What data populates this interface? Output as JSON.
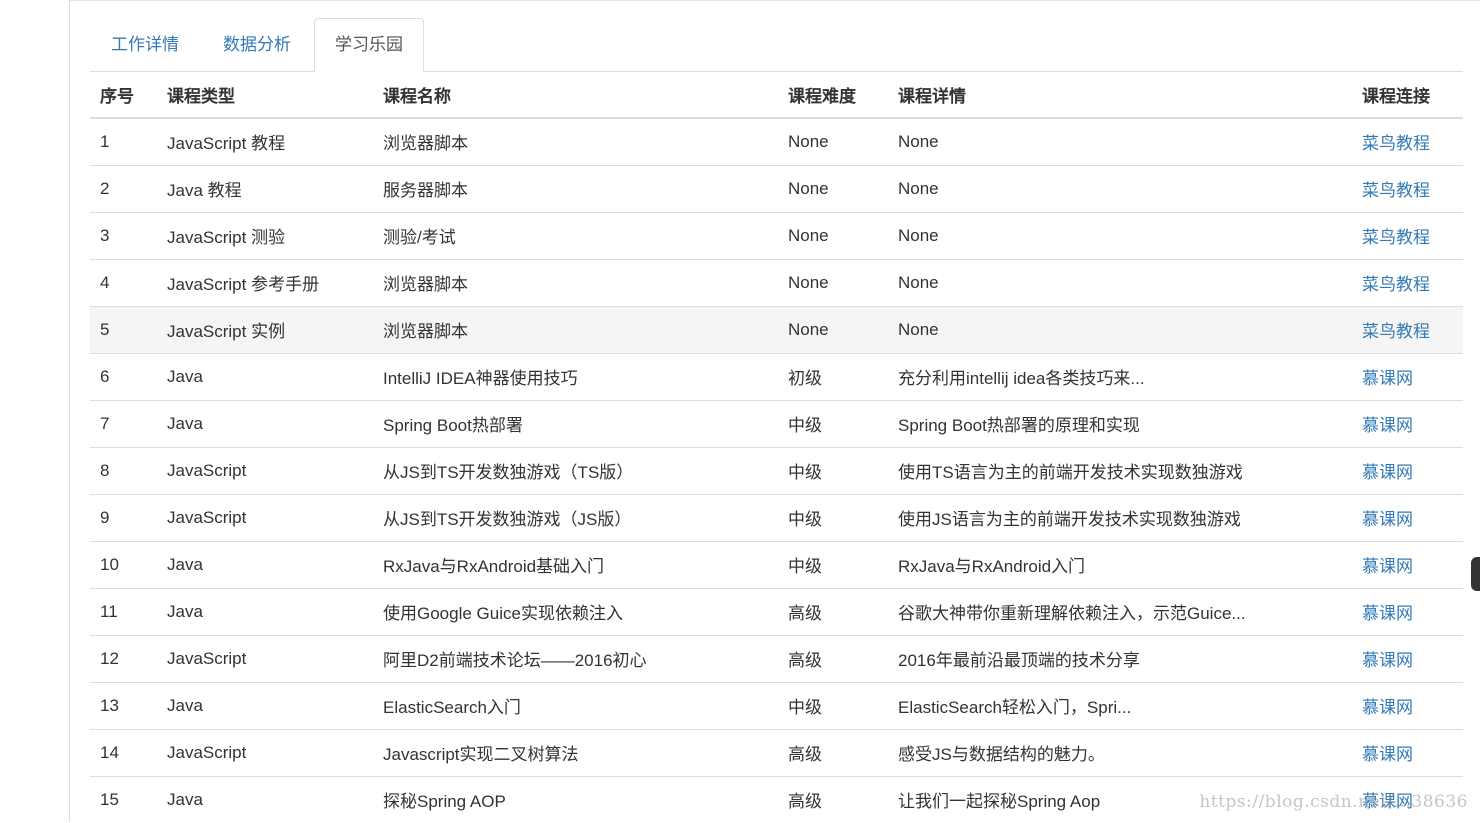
{
  "tabs": [
    {
      "label": "工作详情",
      "active": false
    },
    {
      "label": "数据分析",
      "active": false
    },
    {
      "label": "学习乐园",
      "active": true
    }
  ],
  "table": {
    "headers": [
      "序号",
      "课程类型",
      "课程名称",
      "课程难度",
      "课程详情",
      "课程连接"
    ],
    "rows": [
      {
        "id": "1",
        "type": "JavaScript 教程",
        "name": "浏览器脚本",
        "level": "None",
        "detail": "None",
        "link": "菜鸟教程"
      },
      {
        "id": "2",
        "type": "Java 教程",
        "name": "服务器脚本",
        "level": "None",
        "detail": "None",
        "link": "菜鸟教程"
      },
      {
        "id": "3",
        "type": "JavaScript 测验",
        "name": "测验/考试",
        "level": "None",
        "detail": "None",
        "link": "菜鸟教程"
      },
      {
        "id": "4",
        "type": "JavaScript 参考手册",
        "name": "浏览器脚本",
        "level": "None",
        "detail": "None",
        "link": "菜鸟教程"
      },
      {
        "id": "5",
        "type": "JavaScript 实例",
        "name": "浏览器脚本",
        "level": "None",
        "detail": "None",
        "link": "菜鸟教程",
        "hover": true
      },
      {
        "id": "6",
        "type": "Java",
        "name": "IntelliJ IDEA神器使用技巧",
        "level": "初级",
        "detail": "充分利用intellij idea各类技巧来...",
        "link": "慕课网"
      },
      {
        "id": "7",
        "type": "Java",
        "name": "Spring Boot热部署",
        "level": "中级",
        "detail": "Spring Boot热部署的原理和实现",
        "link": "慕课网"
      },
      {
        "id": "8",
        "type": "JavaScript",
        "name": "从JS到TS开发数独游戏（TS版）",
        "level": "中级",
        "detail": "使用TS语言为主的前端开发技术实现数独游戏",
        "link": "慕课网"
      },
      {
        "id": "9",
        "type": "JavaScript",
        "name": "从JS到TS开发数独游戏（JS版）",
        "level": "中级",
        "detail": "使用JS语言为主的前端开发技术实现数独游戏",
        "link": "慕课网"
      },
      {
        "id": "10",
        "type": "Java",
        "name": "RxJava与RxAndroid基础入门",
        "level": "中级",
        "detail": "RxJava与RxAndroid入门",
        "link": "慕课网"
      },
      {
        "id": "11",
        "type": "Java",
        "name": "使用Google Guice实现依赖注入",
        "level": "高级",
        "detail": "谷歌大神带你重新理解依赖注入，示范Guice...",
        "link": "慕课网"
      },
      {
        "id": "12",
        "type": "JavaScript",
        "name": "阿里D2前端技术论坛——2016初心",
        "level": "高级",
        "detail": "2016年最前沿最顶端的技术分享",
        "link": "慕课网"
      },
      {
        "id": "13",
        "type": "Java",
        "name": "ElasticSearch入门",
        "level": "中级",
        "detail": "ElasticSearch轻松入门，Spri...",
        "link": "慕课网"
      },
      {
        "id": "14",
        "type": "JavaScript",
        "name": "Javascript实现二叉树算法",
        "level": "高级",
        "detail": "感受JS与数据结构的魅力。",
        "link": "慕课网"
      },
      {
        "id": "15",
        "type": "Java",
        "name": "探秘Spring AOP",
        "level": "高级",
        "detail": "让我们一起探秘Spring Aop",
        "link": "慕课网"
      }
    ]
  },
  "watermark": "https://blog.csdn.net/...38636",
  "colors": {
    "link": "#337ab7",
    "border": "#dddddd",
    "hover_row": "#f5f5f5",
    "text": "#333333"
  }
}
